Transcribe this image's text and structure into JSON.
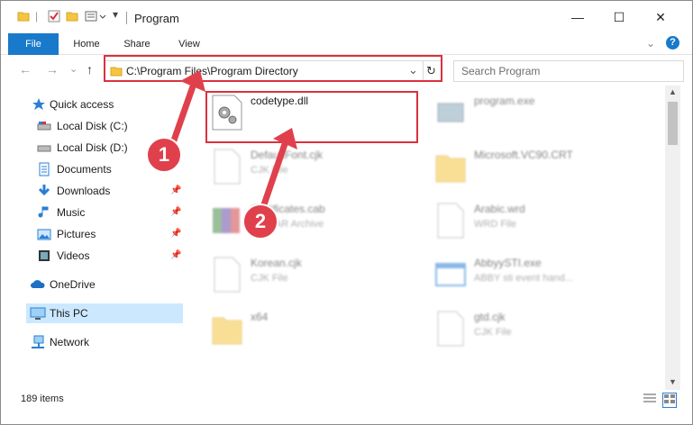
{
  "window": {
    "title": "Program",
    "minimize": "—",
    "maximize": "☐",
    "close": "✕"
  },
  "ribbon": {
    "tabs": [
      "File",
      "Home",
      "Share",
      "View"
    ]
  },
  "address": {
    "path": "C:\\Program Files\\Program Directory",
    "refresh": "↻",
    "dropdown": "⌄"
  },
  "search": {
    "placeholder": "Search Program"
  },
  "nav": {
    "back": "←",
    "forward": "→",
    "recent": "⌄",
    "up": "↑"
  },
  "sidebar": {
    "items": [
      {
        "label": "Quick access",
        "icon": "star-icon"
      },
      {
        "label": "Local Disk (C:)",
        "icon": "drive-icon"
      },
      {
        "label": "Local Disk (D:)",
        "icon": "drive-icon"
      },
      {
        "label": "Documents",
        "icon": "documents-icon"
      },
      {
        "label": "Downloads",
        "icon": "download-arrow-icon"
      },
      {
        "label": "Music",
        "icon": "music-note-icon"
      },
      {
        "label": "Pictures",
        "icon": "pictures-icon"
      },
      {
        "label": "Videos",
        "icon": "video-icon"
      },
      {
        "label": "OneDrive",
        "icon": "cloud-icon"
      },
      {
        "label": "This PC",
        "icon": "monitor-icon"
      },
      {
        "label": "Network",
        "icon": "network-icon"
      }
    ]
  },
  "files": [
    {
      "name": "codetype.dll",
      "type": "",
      "icon": "dll-gear-icon"
    },
    {
      "name": "program.exe",
      "type": "",
      "icon": "exe-icon"
    },
    {
      "name": "DefaultFont.cjk",
      "type": "CJK File",
      "icon": "document-icon"
    },
    {
      "name": "Microsoft.VC90.CRT",
      "type": "",
      "icon": "folder-icon"
    },
    {
      "name": "Certificates.cab",
      "type": "WinRAR Archive",
      "icon": "archive-icon"
    },
    {
      "name": "Arabic.wrd",
      "type": "WRD File",
      "icon": "document-icon"
    },
    {
      "name": "Korean.cjk",
      "type": "CJK File",
      "icon": "document-icon"
    },
    {
      "name": "AbbyySTI.exe",
      "type": "ABBY sti event hand...",
      "icon": "exe-icon"
    },
    {
      "name": "x64",
      "type": "",
      "icon": "folder-icon"
    },
    {
      "name": "gtd.cjk",
      "type": "CJK File",
      "icon": "document-icon"
    }
  ],
  "status": {
    "items_count": "189 items"
  },
  "annotations": {
    "badge1": "1",
    "badge2": "2"
  },
  "colors": {
    "accent": "#1979ca",
    "highlight": "#d9323e",
    "selected": "#cce8ff"
  }
}
